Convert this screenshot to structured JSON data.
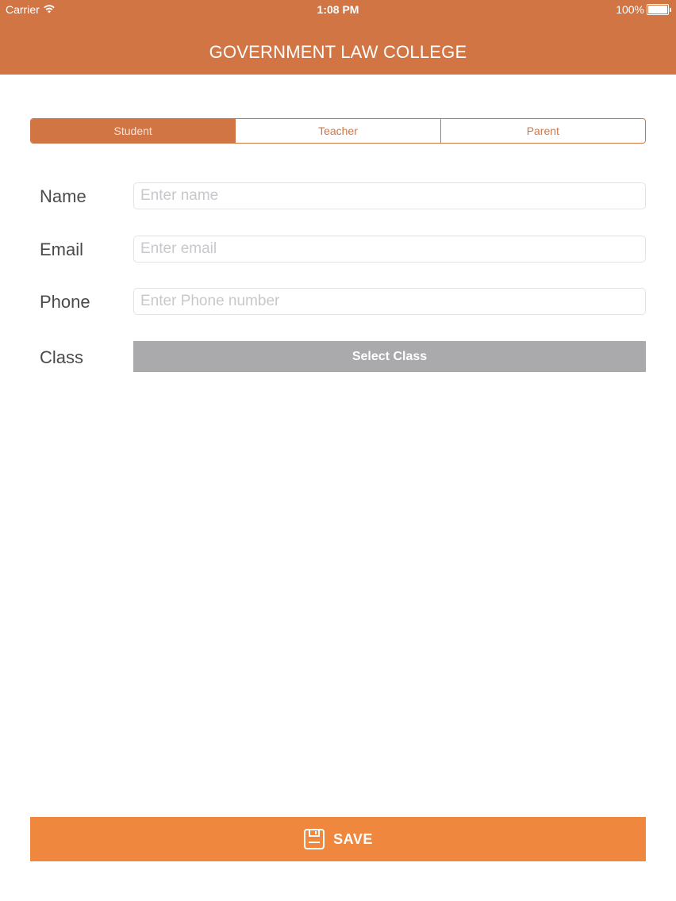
{
  "status_bar": {
    "carrier": "Carrier",
    "time": "1:08 PM",
    "battery": "100%",
    "wifi_icon": "wifi-icon",
    "battery_icon": "battery-icon"
  },
  "header": {
    "title": "GOVERNMENT LAW COLLEGE",
    "background_color": "#d27545"
  },
  "role_selector": {
    "segments": [
      {
        "label": "Student",
        "selected": true
      },
      {
        "label": "Teacher",
        "selected": false
      },
      {
        "label": "Parent",
        "selected": false
      }
    ]
  },
  "form": {
    "name": {
      "label": "Name",
      "value": "",
      "placeholder": "Enter name"
    },
    "email": {
      "label": "Email",
      "value": "",
      "placeholder": "Enter email"
    },
    "phone": {
      "label": "Phone",
      "value": "",
      "placeholder": "Enter Phone number"
    },
    "class": {
      "label": "Class",
      "button_label": "Select Class"
    }
  },
  "save_button": {
    "label": "SAVE",
    "icon": "floppy-disk-icon",
    "color": "#f0873f"
  }
}
